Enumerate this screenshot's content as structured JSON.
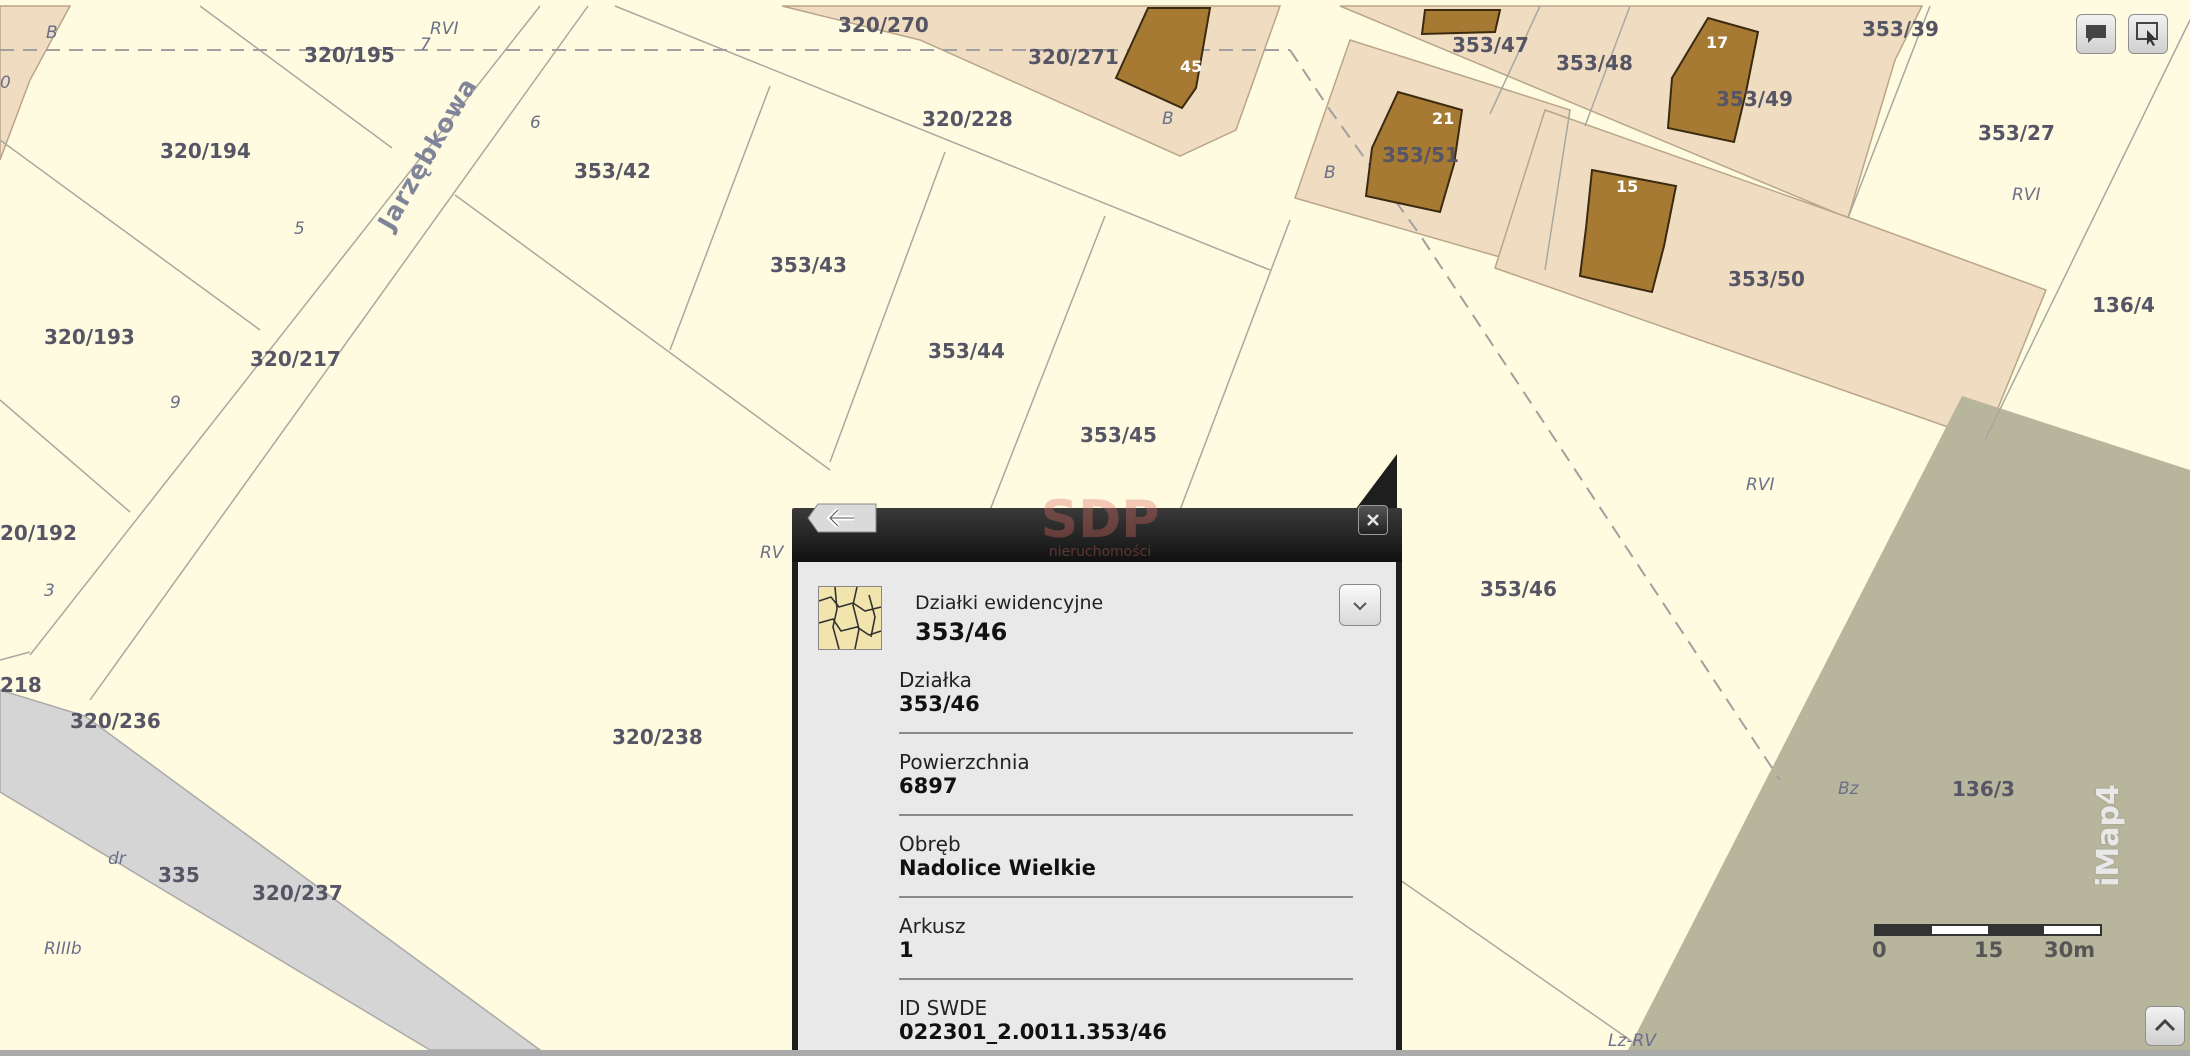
{
  "map": {
    "street_name": "Jarzębkowa",
    "parcel_labels": [
      "320/270",
      "320/271",
      "320/195",
      "320/194",
      "320/228",
      "353/42",
      "353/47",
      "353/48",
      "353/49",
      "353/39",
      "353/27",
      "353/51",
      "353/50",
      "136/4",
      "353/43",
      "353/44",
      "353/45",
      "320/193",
      "320/217",
      "20/192",
      "218",
      "320/236",
      "320/238",
      "353/46",
      "136/3",
      "335",
      "320/237"
    ],
    "class_labels": [
      "B",
      "RVI",
      "B",
      "B",
      "RVI",
      "RV",
      "RVI",
      "Bz",
      "dr",
      "RIIIb",
      "Lz-RV"
    ],
    "house_numbers": [
      "45",
      "17",
      "21",
      "15",
      "7",
      "6",
      "5",
      "9",
      "3",
      "0"
    ]
  },
  "toolbar": {
    "comment_icon": "speech-bubble-icon",
    "identify_icon": "identify-cursor-icon"
  },
  "logo": {
    "text": "iMap4"
  },
  "scale": {
    "labels": [
      "0",
      "15",
      "30m"
    ]
  },
  "popup": {
    "watermark_main": "SDP",
    "watermark_sub": "nieruchomości",
    "layer_title": "Działki ewidencyjne",
    "layer_value": "353/46",
    "fields": [
      {
        "label": "Działka",
        "value": "353/46"
      },
      {
        "label": "Powierzchnia",
        "value": "6897"
      },
      {
        "label": "Obręb",
        "value": "Nadolice Wielkie"
      },
      {
        "label": "Arkusz",
        "value": "1"
      },
      {
        "label": "ID SWDE",
        "value": "022301_2.0011.353/46"
      }
    ]
  },
  "colors": {
    "land": "#fffbe0",
    "built_zone": "#f0dcc0",
    "building": "#a67a32",
    "road": "#d5d5d5",
    "forest": "#b7b59c",
    "popup_bg": "#e9e9e9",
    "popup_header": "#1a1a1a"
  }
}
